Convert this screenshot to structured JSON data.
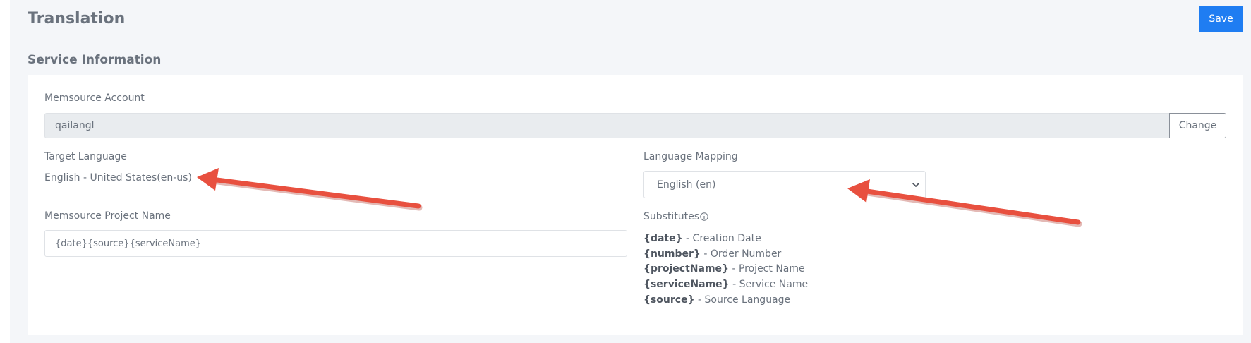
{
  "header": {
    "title": "Translation",
    "save_label": "Save"
  },
  "section": {
    "title": "Service Information"
  },
  "account": {
    "label": "Memsource Account",
    "value": "qailangl",
    "change_label": "Change"
  },
  "target_language": {
    "label": "Target Language",
    "value": "English - United States(en-us)"
  },
  "language_mapping": {
    "label": "Language Mapping",
    "selected": "English (en)"
  },
  "project_name": {
    "label": "Memsource Project Name",
    "value": "{date}{source}{serviceName}"
  },
  "substitutes": {
    "label": "Substitutes",
    "items": [
      {
        "key": "{date}",
        "desc": " - Creation Date"
      },
      {
        "key": "{number}",
        "desc": " - Order Number"
      },
      {
        "key": "{projectName}",
        "desc": " - Project Name"
      },
      {
        "key": "{serviceName}",
        "desc": " - Service Name"
      },
      {
        "key": "{source}",
        "desc": " - Source Language"
      }
    ]
  },
  "colors": {
    "accent": "#1f7df2",
    "annotation_arrow": "#e8503f"
  },
  "icons": [
    "info-icon",
    "chevron-down-icon"
  ]
}
